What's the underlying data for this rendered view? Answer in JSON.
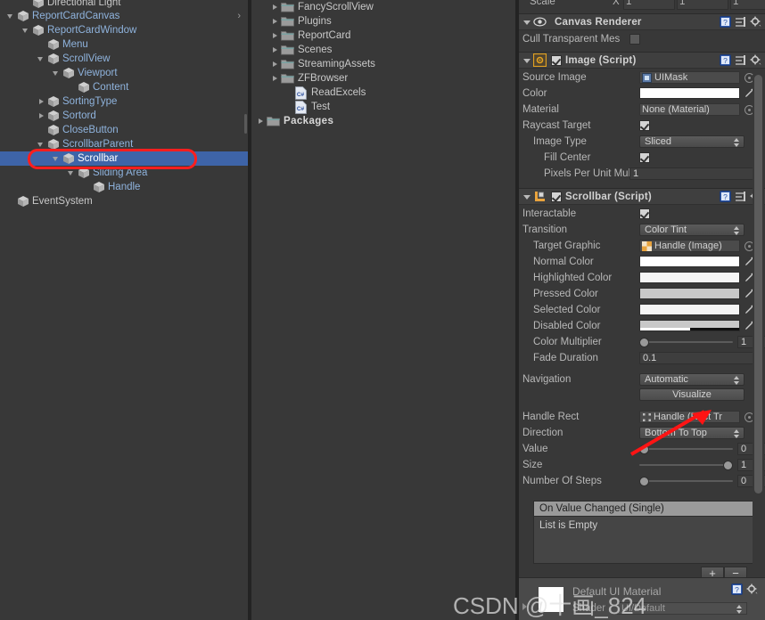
{
  "hierarchy": {
    "rows": [
      {
        "label": "Directional Light",
        "depth": 1,
        "arrow": "none",
        "style": "white",
        "selected": false,
        "clipped": true
      },
      {
        "label": "ReportCardCanvas",
        "depth": 0,
        "arrow": "down",
        "style": "link",
        "selected": false
      },
      {
        "label": "ReportCardWindow",
        "depth": 1,
        "arrow": "down",
        "style": "link",
        "selected": false
      },
      {
        "label": "Menu",
        "depth": 2,
        "arrow": "none",
        "style": "link",
        "selected": false
      },
      {
        "label": "ScrollView",
        "depth": 2,
        "arrow": "down",
        "style": "link",
        "selected": false
      },
      {
        "label": "Viewport",
        "depth": 3,
        "arrow": "down",
        "style": "link",
        "selected": false
      },
      {
        "label": "Content",
        "depth": 4,
        "arrow": "none",
        "style": "link",
        "selected": false
      },
      {
        "label": "SortingType",
        "depth": 2,
        "arrow": "right",
        "style": "link",
        "selected": false
      },
      {
        "label": "Sortord",
        "depth": 2,
        "arrow": "right",
        "style": "link",
        "selected": false
      },
      {
        "label": "CloseButton",
        "depth": 2,
        "arrow": "none",
        "style": "link",
        "selected": false
      },
      {
        "label": "ScrollbarParent",
        "depth": 2,
        "arrow": "down",
        "style": "link",
        "selected": false
      },
      {
        "label": "Scrollbar",
        "depth": 3,
        "arrow": "down",
        "style": "link",
        "selected": true
      },
      {
        "label": "Sliding Area",
        "depth": 4,
        "arrow": "down",
        "style": "link",
        "selected": false
      },
      {
        "label": "Handle",
        "depth": 5,
        "arrow": "none",
        "style": "link",
        "selected": false
      },
      {
        "label": "EventSystem",
        "depth": 0,
        "arrow": "none",
        "style": "white",
        "selected": false
      }
    ],
    "overflow_chevron": "›"
  },
  "project": {
    "rows": [
      {
        "label": "FancyScrollView",
        "depth": 1,
        "arrow": "right",
        "icon": "folder-icon",
        "bold": false
      },
      {
        "label": "Plugins",
        "depth": 1,
        "arrow": "right",
        "icon": "folder-icon",
        "bold": false
      },
      {
        "label": "ReportCard",
        "depth": 1,
        "arrow": "right",
        "icon": "folder-icon",
        "bold": false
      },
      {
        "label": "Scenes",
        "depth": 1,
        "arrow": "right",
        "icon": "folder-icon",
        "bold": false
      },
      {
        "label": "StreamingAssets",
        "depth": 1,
        "arrow": "right",
        "icon": "folder-icon",
        "bold": false
      },
      {
        "label": "ZFBrowser",
        "depth": 1,
        "arrow": "right",
        "icon": "folder-icon",
        "bold": false
      },
      {
        "label": "ReadExcels",
        "depth": 2,
        "arrow": "none",
        "icon": "csharp-script-icon",
        "bold": false
      },
      {
        "label": "Test",
        "depth": 2,
        "arrow": "none",
        "icon": "csharp-script-icon",
        "bold": false
      },
      {
        "label": "Packages",
        "depth": 0,
        "arrow": "right",
        "icon": "folder-icon",
        "bold": true
      }
    ]
  },
  "inspector": {
    "transform_tail": {
      "label": "Scale",
      "axes": [
        {
          "axis": "X",
          "value": "1"
        },
        {
          "axis": "Y",
          "value": "1"
        },
        {
          "axis": "Z",
          "value": "1"
        }
      ]
    },
    "canvas_renderer": {
      "title": "Canvas Renderer",
      "icon": "eye-icon",
      "help_icon": "help-book-icon",
      "preset_icon": "preset-icon",
      "gear_icon": "gear-icon",
      "cull_label": "Cull Transparent Mes",
      "cull_checked": false
    },
    "image_component": {
      "title": "Image (Script)",
      "enabled": true,
      "icon": "image-script-icon",
      "help_icon": "help-book-icon",
      "preset_icon": "preset-icon",
      "gear_icon": "gear-icon",
      "fields": [
        {
          "label": "Source Image",
          "type": "object",
          "value": "UIMask",
          "indent": 0,
          "thumb": "sprite-icon"
        },
        {
          "label": "Color",
          "type": "color",
          "value": "#FFFFFF",
          "indent": 0
        },
        {
          "label": "Material",
          "type": "object",
          "value": "None (Material)",
          "indent": 0,
          "thumb": "none"
        },
        {
          "label": "Raycast Target",
          "type": "checkbox",
          "value": true,
          "indent": 0
        },
        {
          "label": "Image Type",
          "type": "dropdown",
          "value": "Sliced",
          "indent": 1
        },
        {
          "label": "Fill Center",
          "type": "checkbox",
          "value": true,
          "indent": 2
        },
        {
          "label": "Pixels Per Unit Mul",
          "type": "text",
          "value": "1",
          "indent": 2
        }
      ]
    },
    "scrollbar_component": {
      "title": "Scrollbar (Script)",
      "enabled": true,
      "icon": "scrollbar-script-icon",
      "help_icon": "help-book-icon",
      "preset_icon": "preset-icon",
      "gear_icon": "gear-icon",
      "interactable_label": "Interactable",
      "interactable": true,
      "transition_label": "Transition",
      "transition_value": "Color Tint",
      "target_graphic_label": "Target Graphic",
      "target_graphic_value": "Handle (Image)",
      "colors": [
        {
          "label": "Normal Color",
          "swatch": "#FFFFFF",
          "alpha": 1
        },
        {
          "label": "Highlighted Color",
          "swatch": "#F5F5F5",
          "alpha": 1
        },
        {
          "label": "Pressed Color",
          "swatch": "#C8C8C8",
          "alpha": 1
        },
        {
          "label": "Selected Color",
          "swatch": "#F5F5F5",
          "alpha": 1
        },
        {
          "label": "Disabled Color",
          "swatch": "#C8C8C8",
          "alpha": 0.5
        }
      ],
      "color_multiplier_label": "Color Multiplier",
      "color_multiplier_value": "1",
      "fade_duration_label": "Fade Duration",
      "fade_duration_value": "0.1",
      "navigation_label": "Navigation",
      "navigation_value": "Automatic",
      "visualize_button": "Visualize",
      "handle_rect_label": "Handle Rect",
      "handle_rect_value": "Handle (Rect Tr",
      "direction_label": "Direction",
      "direction_value": "Bottom To Top",
      "sliders": [
        {
          "label": "Value",
          "value": "0",
          "knob_pct": 0
        },
        {
          "label": "Size",
          "value": "1",
          "knob_pct": 100
        },
        {
          "label": "Number Of Steps",
          "value": "0",
          "knob_pct": 0
        }
      ],
      "event_header": "On Value Changed (Single)",
      "event_empty": "List is Empty",
      "add_button": "+",
      "remove_button": "−"
    },
    "material_preview": {
      "name": "Default UI Material",
      "shader_label": "Shader",
      "shader_value": "UI/Default",
      "help_icon": "help-book-icon",
      "gear_icon": "gear-icon"
    }
  },
  "annotations": {
    "selection_rect_color": "#FF1E1E",
    "arrow_color": "#FF1E1E",
    "watermark": "CSDN @十画_824"
  }
}
